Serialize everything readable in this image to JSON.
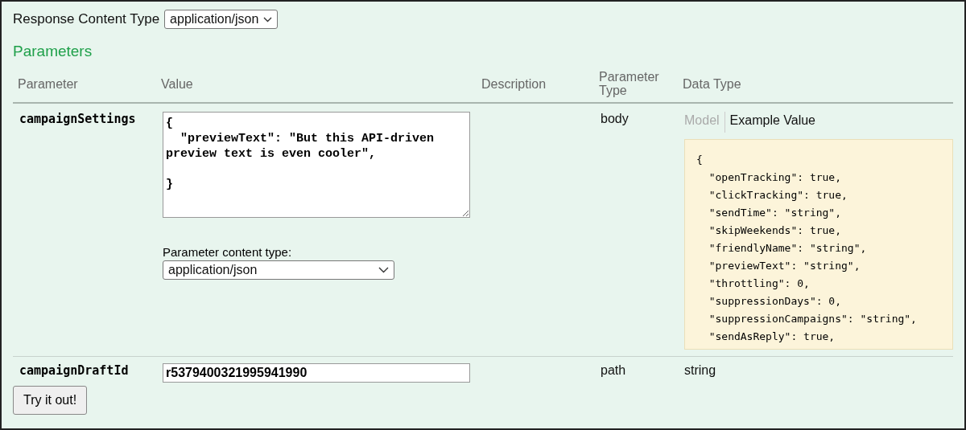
{
  "response_content_type": {
    "label": "Response Content Type",
    "value": "application/json"
  },
  "parameters_title": "Parameters",
  "table": {
    "columns": [
      "Parameter",
      "Value",
      "Description",
      "Parameter Type",
      "Data Type"
    ],
    "rows": [
      {
        "kind": "body",
        "name": "campaignSettings",
        "value": "{\n  \"previewText\": \"But this API-driven preview text is even cooler\",\n\n}",
        "content_type_label": "Parameter content type:",
        "content_type": "application/json",
        "parameter_type": "body",
        "data_tabs": [
          {
            "label": "Model",
            "selected": false
          },
          {
            "label": "Example Value",
            "selected": true
          }
        ],
        "example_lines": [
          "{",
          "  \"openTracking\": true,",
          "  \"clickTracking\": true,",
          "  \"sendTime\": \"string\",",
          "  \"skipWeekends\": true,",
          "  \"friendlyName\": \"string\",",
          "  \"previewText\": \"string\",",
          "  \"throttling\": 0,",
          "  \"suppressionDays\": 0,",
          "  \"suppressionCampaigns\": \"string\",",
          "  \"sendAsReply\": true,"
        ]
      },
      {
        "kind": "text",
        "name": "campaignDraftId",
        "value": "r5379400321995941990",
        "parameter_type": "path",
        "data_type": "string"
      }
    ]
  },
  "button": "Try it out!"
}
